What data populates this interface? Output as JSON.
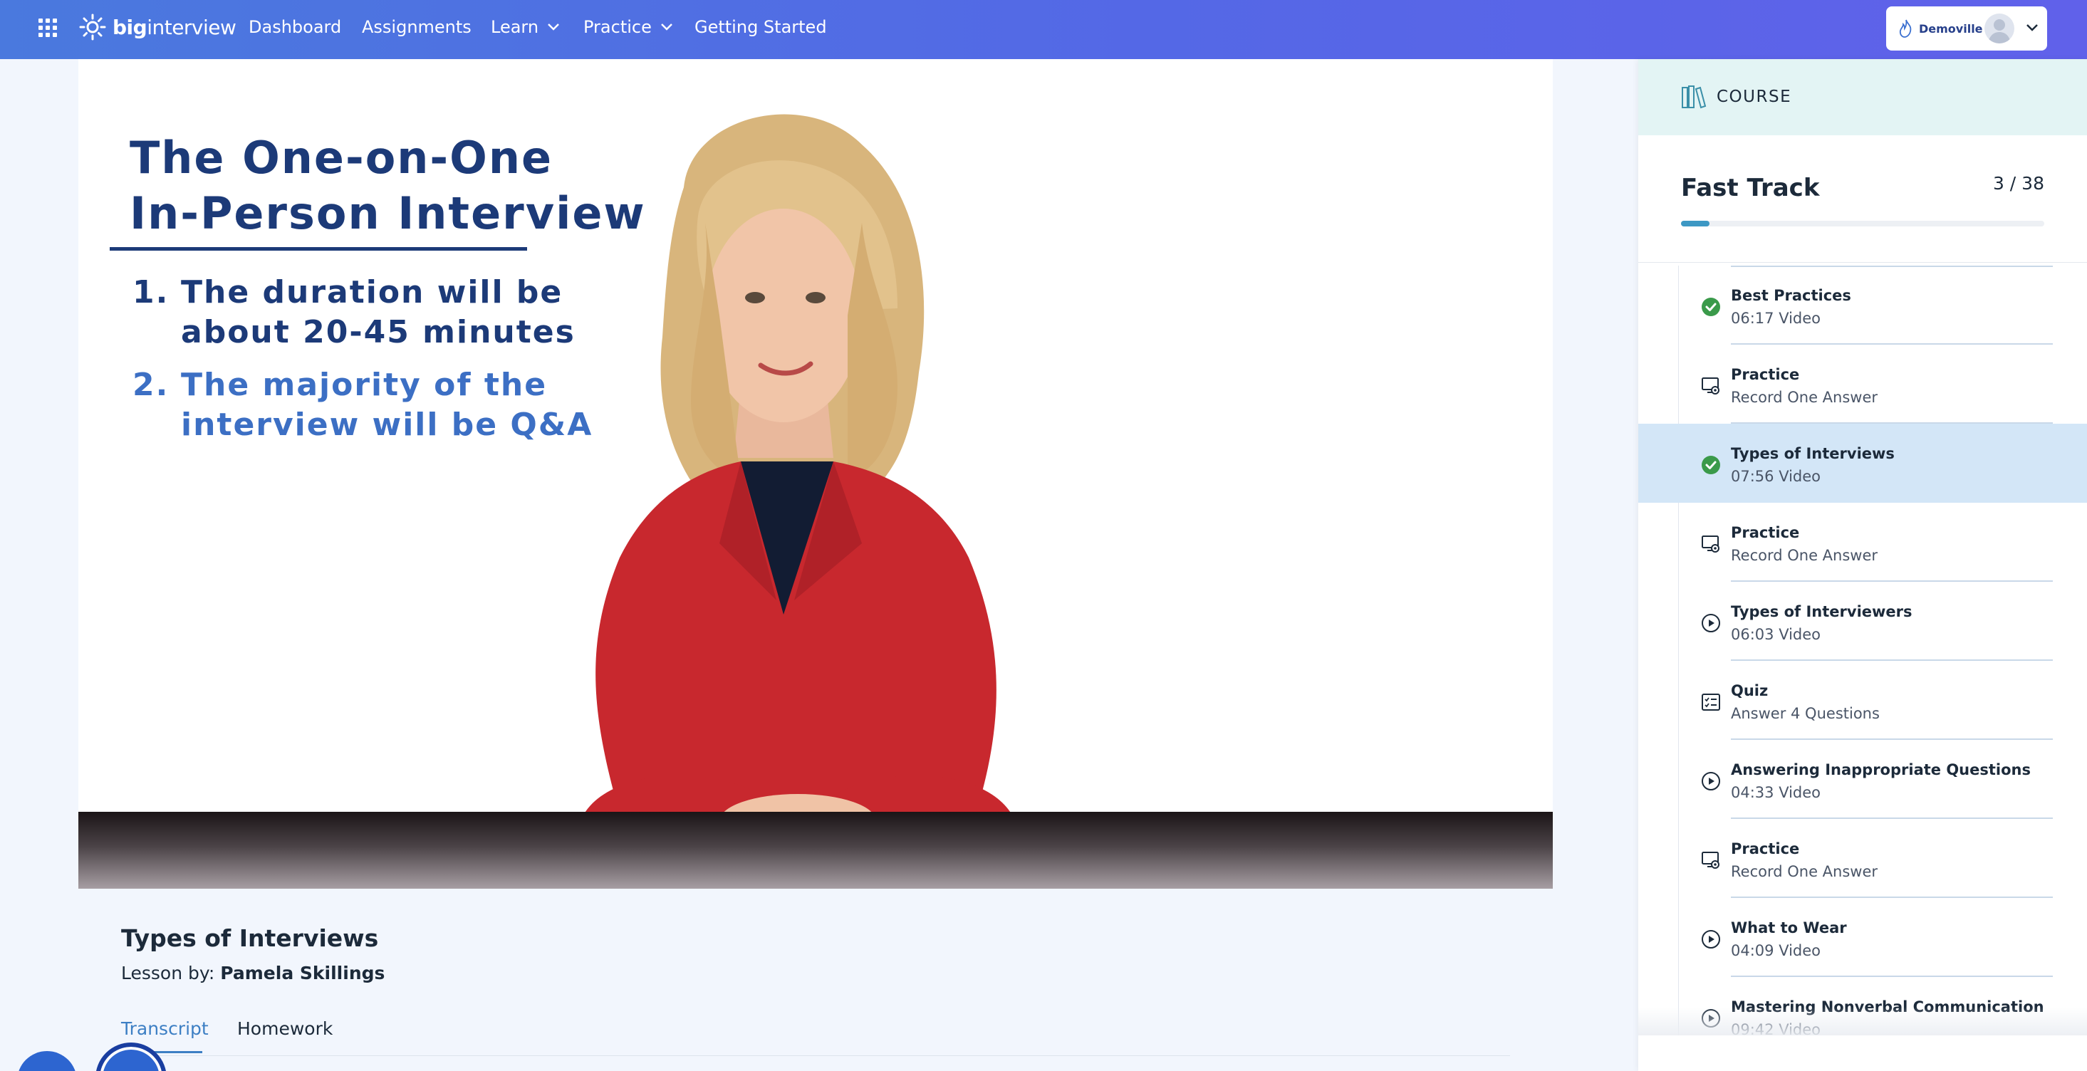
{
  "nav": {
    "brand_bold": "big",
    "brand_light": "interview",
    "links": [
      "Dashboard",
      "Assignments",
      "Learn",
      "Practice",
      "Getting Started"
    ],
    "account_name": "Demoville",
    "icons": {
      "apps": "apps-grid-icon",
      "logo": "sun-logo-icon",
      "account_menu": "chevron-down-icon"
    }
  },
  "video": {
    "slide_title_line1": "The One-on-One",
    "slide_title_line2": "In-Person Interview",
    "items": [
      {
        "num": "1.",
        "line1": "The duration will be",
        "line2": "about 20-45 minutes"
      },
      {
        "num": "2.",
        "line1": "The majority of the",
        "line2": "interview will be Q&A"
      }
    ],
    "colors": {
      "title": "#1c3a78",
      "highlight": "#3c6fc4"
    }
  },
  "lesson": {
    "title": "Types of Interviews",
    "by_label": "Lesson by:",
    "author": "Pamela Skillings",
    "tabs": [
      "Transcript",
      "Homework"
    ],
    "active_tab": "Transcript"
  },
  "sidebar": {
    "header_label": "COURSE",
    "course_title": "Fast Track",
    "position": "3 / 38",
    "progress_fraction": 0.079,
    "items": [
      {
        "title": "Best Practices",
        "meta": "06:17 Video",
        "icon": "check-circle-icon",
        "status": "completed"
      },
      {
        "title": "Practice",
        "meta": "Record One Answer",
        "icon": "practice-monitor-icon",
        "status": "pending"
      },
      {
        "title": "Types of Interviews",
        "meta": "07:56 Video",
        "icon": "check-circle-icon",
        "status": "completed",
        "active": true
      },
      {
        "title": "Practice",
        "meta": "Record One Answer",
        "icon": "practice-monitor-icon",
        "status": "pending"
      },
      {
        "title": "Types of Interviewers",
        "meta": "06:03 Video",
        "icon": "play-circle-icon",
        "status": "pending"
      },
      {
        "title": "Quiz",
        "meta": "Answer 4 Questions",
        "icon": "quiz-checklist-icon",
        "status": "pending"
      },
      {
        "title": "Answering Inappropriate Questions",
        "meta": "04:33 Video",
        "icon": "play-circle-icon",
        "status": "pending"
      },
      {
        "title": "Practice",
        "meta": "Record One Answer",
        "icon": "practice-monitor-icon",
        "status": "pending"
      },
      {
        "title": "What to Wear",
        "meta": "04:09 Video",
        "icon": "play-circle-icon",
        "status": "pending"
      },
      {
        "title": "Mastering Nonverbal Communication",
        "meta": "09:42 Video",
        "icon": "play-circle-icon",
        "status": "pending"
      }
    ],
    "colors": {
      "completed": "#3a9a4a",
      "active_bg": "#d3e6f7",
      "progress": "#3d98c4"
    }
  }
}
